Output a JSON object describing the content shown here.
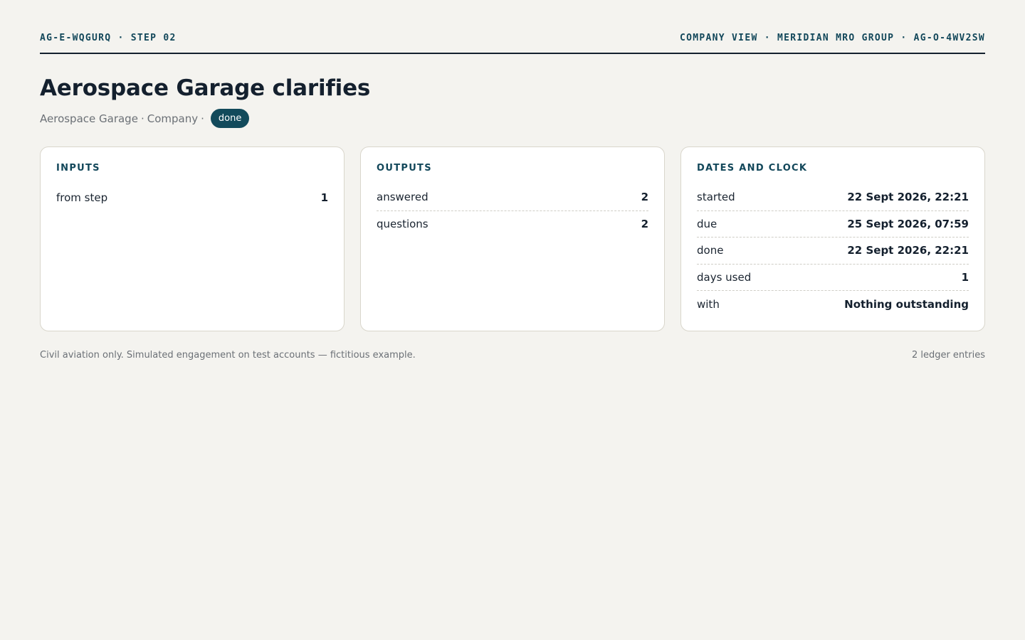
{
  "header": {
    "left": "AG-E-WQGURQ · STEP 02",
    "right": "COMPANY VIEW · MERIDIAN MRO GROUP · AG-O-4WV2SW"
  },
  "title": "Aerospace Garage clarifies",
  "subtitle": {
    "party": "Aerospace Garage",
    "role": "Company",
    "status": "done"
  },
  "cards": {
    "inputs": {
      "heading": "INPUTS",
      "rows": [
        {
          "label": "from step",
          "value": "1"
        }
      ]
    },
    "outputs": {
      "heading": "OUTPUTS",
      "rows": [
        {
          "label": "answered",
          "value": "2"
        },
        {
          "label": "questions",
          "value": "2"
        }
      ]
    },
    "dates": {
      "heading": "DATES AND CLOCK",
      "rows": [
        {
          "label": "started",
          "value": "22 Sept 2026, 22:21"
        },
        {
          "label": "due",
          "value": "25 Sept 2026, 07:59"
        },
        {
          "label": "done",
          "value": "22 Sept 2026, 22:21"
        },
        {
          "label": "days used",
          "value": "1"
        },
        {
          "label": "with",
          "value": "Nothing outstanding"
        }
      ]
    }
  },
  "footer": {
    "note": "Civil aviation only. Simulated engagement on test accounts — fictitious example.",
    "entries": "2 ledger entries"
  },
  "colors": {
    "background": "#f4f3ef",
    "accent": "#124a5b",
    "text": "#14202e"
  }
}
